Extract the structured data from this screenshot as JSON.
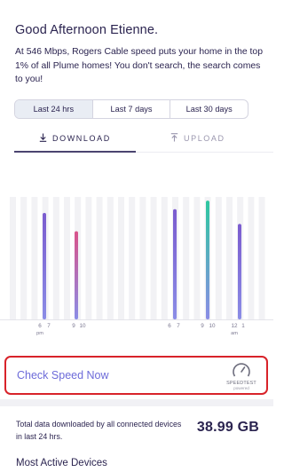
{
  "header": {
    "greeting": "Good Afternoon Etienne.",
    "summary": "At 546 Mbps, Rogers Cable speed puts your home in the top 1% of all Plume homes! You don't search, the search comes to you!"
  },
  "range_selector": {
    "options": [
      "Last 24 hrs",
      "Last 7 days",
      "Last 30 days"
    ],
    "selected": "Last 24 hrs"
  },
  "tabs": {
    "download": "DOWNLOAD",
    "upload": "UPLOAD",
    "active": "DOWNLOAD"
  },
  "chart_data": {
    "type": "bar",
    "categories": [
      "6",
      "7",
      "9",
      "10",
      "6",
      "7",
      "9",
      "10",
      "12",
      "1"
    ],
    "tick_labels": [
      {
        "text": "6",
        "sub": "pm"
      },
      {
        "text": "7",
        "sub": ""
      },
      {
        "text": "9",
        "sub": ""
      },
      {
        "text": "10",
        "sub": ""
      },
      {
        "text": "6",
        "sub": ""
      },
      {
        "text": "7",
        "sub": ""
      },
      {
        "text": "9",
        "sub": ""
      },
      {
        "text": "10",
        "sub": ""
      },
      {
        "text": "12",
        "sub": "am"
      },
      {
        "text": "1",
        "sub": ""
      }
    ],
    "series": [
      {
        "values": [
          0.87,
          0.72,
          0.9,
          0.97,
          0.78
        ]
      }
    ],
    "bar_colors": [
      "#7b5ccf",
      "#d9538a",
      "#7b5ccf",
      "#2ec8a0",
      "#7b5ccf"
    ],
    "bar_gradient_bottom": "#8b8de6",
    "grid": true
  },
  "check_speed": {
    "label": "Check Speed Now",
    "badge_title": "SPEEDTEST",
    "badge_sub": "powered"
  },
  "totals": {
    "description": "Total data downloaded by all connected devices in last 24 hrs.",
    "value": "38.99 GB"
  },
  "most_active": {
    "title": "Most Active Devices"
  },
  "colors": {
    "text": "#2b2450",
    "accent": "#6d6bd9",
    "highlight_border": "#d8232a"
  }
}
